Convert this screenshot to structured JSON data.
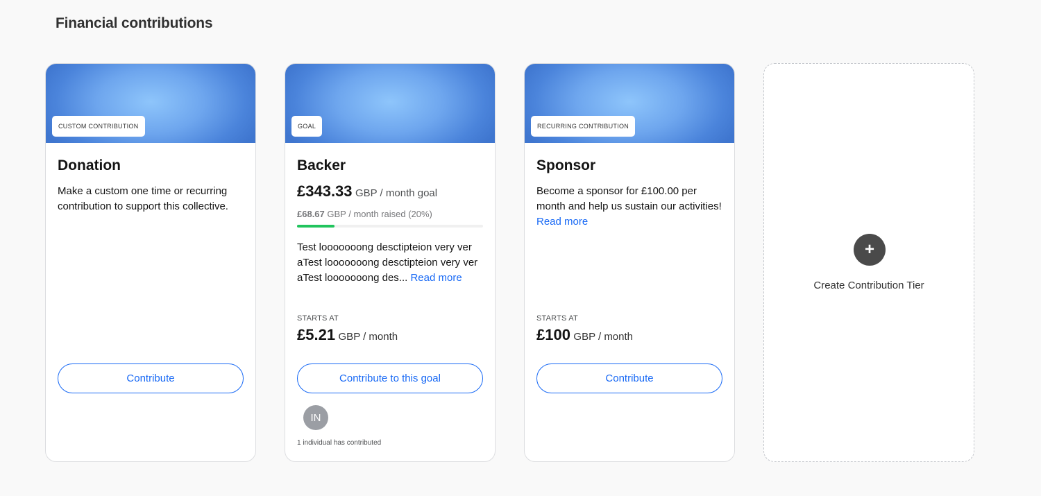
{
  "section": {
    "title": "Financial contributions"
  },
  "cards": [
    {
      "tag": "CUSTOM CONTRIBUTION",
      "name": "Donation",
      "description": "Make a custom one time or recurring contribution to support this collective.",
      "button": "Contribute"
    },
    {
      "tag": "GOAL",
      "name": "Backer",
      "goal_amount": "£343.33",
      "goal_unit": "GBP / month goal",
      "raised_amount": "£68.67",
      "raised_unit": "GBP / month raised (20%)",
      "progress_percent": 20,
      "description": "Test looooooong desctipteion very ver aTest looooooong desctipteion very ver aTest looooooong des...",
      "read_more": "Read more",
      "starts_at_label": "STARTS AT",
      "price": "£5.21",
      "price_unit": "GBP / month",
      "button": "Contribute to this goal",
      "avatar_initials": "IN",
      "contributors_text": "1 individual has contributed"
    },
    {
      "tag": "RECURRING CONTRIBUTION",
      "name": "Sponsor",
      "description": "Become a sponsor for £100.00 per month and help us sustain our activities!",
      "read_more": "Read more",
      "starts_at_label": "STARTS AT",
      "price": "£100",
      "price_unit": "GBP / month",
      "button": "Contribute"
    }
  ],
  "create_tier": {
    "icon": "plus-icon",
    "label": "Create Contribution Tier"
  },
  "colors": {
    "accent": "#1869f5",
    "progress": "#21c45d",
    "banner": "#6ea6ee"
  }
}
